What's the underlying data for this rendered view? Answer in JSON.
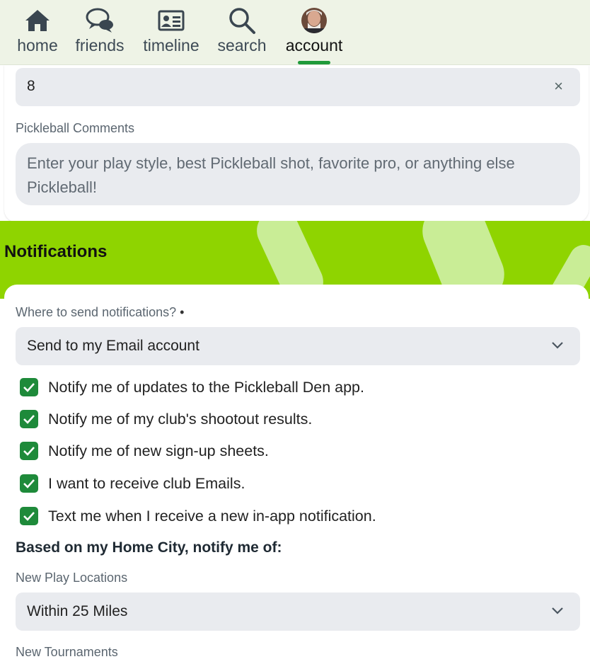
{
  "nav": {
    "items": [
      {
        "label": "home",
        "icon": "home-icon"
      },
      {
        "label": "friends",
        "icon": "chat-bubbles-icon"
      },
      {
        "label": "timeline",
        "icon": "id-card-icon"
      },
      {
        "label": "search",
        "icon": "magnifier-icon"
      },
      {
        "label": "account",
        "icon": "avatar"
      }
    ],
    "active": "account"
  },
  "profile": {
    "number_value": "8",
    "clear_symbol": "×",
    "comments_label": "Pickleball Comments",
    "comments_placeholder": "Enter your play style, best Pickleball shot, favorite pro, or anything else Pickleball!"
  },
  "notifications": {
    "title": "Notifications",
    "send_label": "Where to send notifications?",
    "required_marker": "•",
    "send_value": "Send to my Email account",
    "checkboxes": [
      {
        "label": "Notify me of updates to the Pickleball Den app.",
        "checked": true
      },
      {
        "label": "Notify me of my club's shootout results.",
        "checked": true
      },
      {
        "label": "Notify me of new sign-up sheets.",
        "checked": true
      },
      {
        "label": "I want to receive club Emails.",
        "checked": true
      },
      {
        "label": "Text me when I receive a new in-app notification.",
        "checked": true
      }
    ],
    "home_city_heading": "Based on my Home City, notify me of:",
    "play_locations_label": "New Play Locations",
    "play_locations_value": "Within 25 Miles",
    "tournaments_label": "New Tournaments"
  },
  "colors": {
    "accent_green": "#8fd400",
    "checkbox_green": "#1e8a3a",
    "nav_active_bar": "#1f9a3a",
    "field_bg": "#e9ebef"
  }
}
